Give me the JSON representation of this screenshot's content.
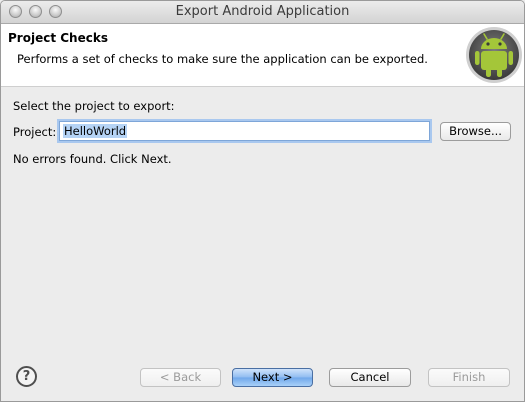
{
  "window": {
    "title": "Export Android Application"
  },
  "header": {
    "title": "Project Checks",
    "description": "Performs a set of checks to make sure the application can be exported.",
    "logo_icon": "android-icon"
  },
  "main": {
    "prompt": "Select the project to export:",
    "project_label": "Project:",
    "project_value": "HelloWorld",
    "browse_label": "Browse...",
    "status": "No errors found. Click Next."
  },
  "footer": {
    "help_glyph": "?",
    "back_label": "< Back",
    "next_label": "Next >",
    "cancel_label": "Cancel",
    "finish_label": "Finish"
  },
  "colors": {
    "android_green": "#a4c639",
    "primary_button": "#6fa7ea"
  }
}
